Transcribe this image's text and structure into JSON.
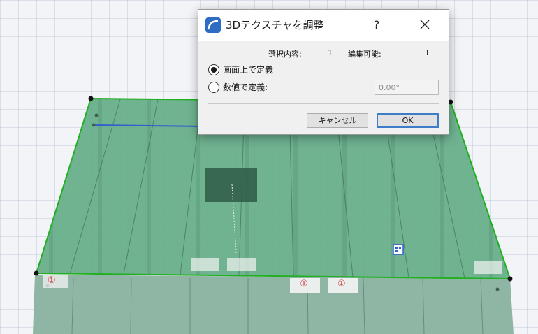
{
  "dialog": {
    "title": "3Dテクスチャを調整",
    "help_label": "?",
    "selection_label": "選択内容:",
    "selection_value": "1",
    "editable_label": "編集可能:",
    "editable_value": "1",
    "option_onscreen_label": "画面上で定義",
    "option_numeric_label": "数値で定義:",
    "angle_value": "0.00°",
    "cancel_label": "キャンセル",
    "ok_label": "OK"
  },
  "scene": {
    "labels": [
      "①",
      "①",
      "③",
      "①"
    ],
    "colors": {
      "surface": "#5fae85",
      "edge": "#22b022",
      "vertex": "#111111",
      "accent": "#2f6cc4"
    }
  }
}
